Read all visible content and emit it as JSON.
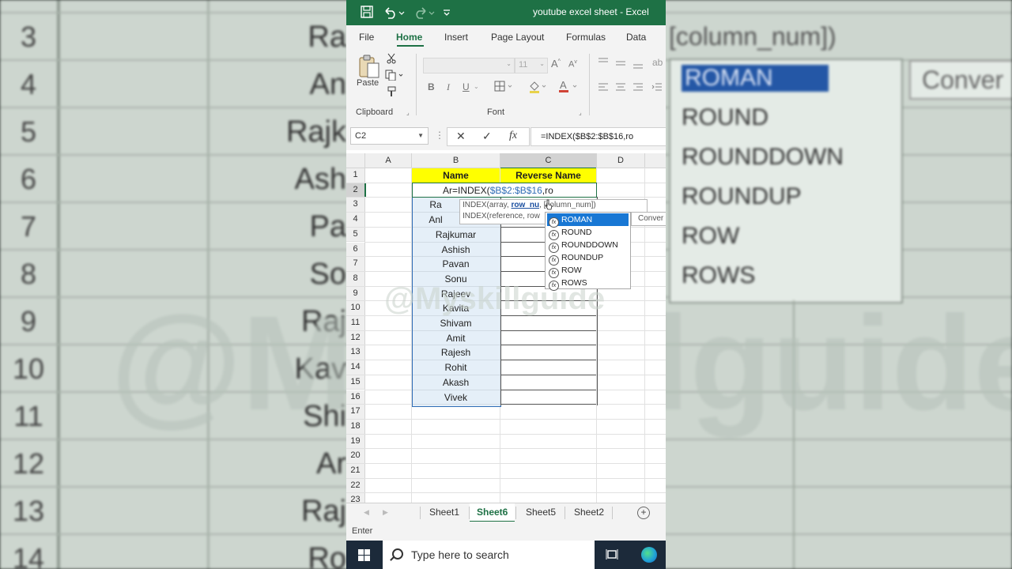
{
  "window": {
    "title": "youtube excel sheet  -  Excel"
  },
  "ribbon_tabs": [
    "File",
    "Home",
    "Insert",
    "Page Layout",
    "Formulas",
    "Data"
  ],
  "ribbon": {
    "paste_label": "Paste",
    "clipboard_label": "Clipboard",
    "font_label": "Font",
    "font_size": "11",
    "bold": "B",
    "italic": "I",
    "underline": "U"
  },
  "formula_bar": {
    "name_box": "C2",
    "cancel": "✕",
    "enter": "✓",
    "fx": "fx",
    "formula": "=INDEX($B$2:$B$16,ro"
  },
  "columns": [
    "A",
    "B",
    "C",
    "D"
  ],
  "rows": [
    "1",
    "2",
    "3",
    "4",
    "5",
    "6",
    "7",
    "8",
    "9",
    "10",
    "11",
    "12",
    "13",
    "14",
    "15",
    "16",
    "17",
    "18",
    "19",
    "20",
    "21",
    "22",
    "23"
  ],
  "headers": {
    "name": "Name",
    "reverse": "Reverse Name"
  },
  "names": [
    "",
    "Ra",
    "Anl",
    "Rajkumar",
    "Ashish",
    "Pavan",
    "Sonu",
    "Rajeev",
    "Kavita",
    "Shivam",
    "Amit",
    "Rajesh",
    "Rohit",
    "Akash",
    "Vivek"
  ],
  "edit": {
    "prefix": "Ar=INDEX(",
    "range": "$B$2:$B$16",
    "suffix": ",ro"
  },
  "tooltip": {
    "line1_pre": "INDEX(array, ",
    "line1_arg": "row_nu",
    "line1_post": ", [column_num])",
    "line2": "INDEX(reference, row"
  },
  "autocomplete": [
    "ROMAN",
    "ROUND",
    "ROUNDDOWN",
    "ROUNDUP",
    "ROW",
    "ROWS"
  ],
  "autocomplete_tip": "Conver",
  "watermark": "@Myskillguide",
  "sheets": [
    "Sheet1",
    "Sheet6",
    "Sheet5",
    "Sheet2"
  ],
  "active_sheet": "Sheet6",
  "status": "Enter",
  "taskbar": {
    "search_placeholder": "Type here to search"
  },
  "background": {
    "row_numbers": [
      "3",
      "4",
      "5",
      "6",
      "7",
      "8",
      "9",
      "10",
      "11",
      "12",
      "13",
      "14"
    ],
    "names": [
      "Ra",
      "An",
      "Rajk",
      "Ash",
      "Pa",
      "So",
      "Raj",
      "Kav",
      "Shi",
      "Ar",
      "Raj",
      "Ro"
    ],
    "formula_hint": "[column_num])",
    "drop_items": [
      "ROMAN",
      "ROUND",
      "ROUNDDOWN",
      "ROUNDUP",
      "ROW",
      "ROWS"
    ],
    "conv": "Conver",
    "watermark": "@Myskillguide"
  },
  "colors": {
    "excel_green": "#1e7145",
    "header_yellow": "#ffff00",
    "selection_blue": "#1877d4",
    "taskbar": "#1c2a3a"
  }
}
